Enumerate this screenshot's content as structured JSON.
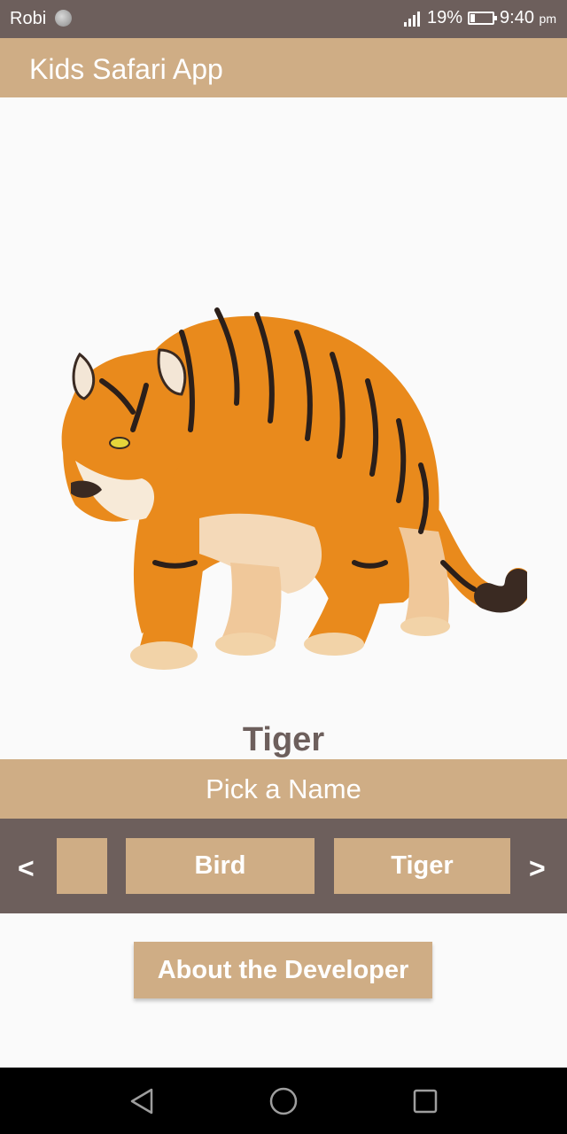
{
  "status": {
    "carrier": "Robi",
    "battery": "19%",
    "time": "9:40",
    "ampm": "pm",
    "battery_level": 0.19
  },
  "app": {
    "title": "Kids Safari App"
  },
  "animal": {
    "name": "Tiger",
    "image_icon": "tiger-illustration"
  },
  "picker": {
    "header": "Pick a Name",
    "prev_label": "<",
    "next_label": ">",
    "options": [
      "",
      "Bird",
      "Tiger"
    ]
  },
  "about": {
    "label": "About the Developer"
  },
  "nav": {
    "icons": [
      "back-triangle-icon",
      "home-circle-icon",
      "recents-square-icon"
    ]
  },
  "colors": {
    "accent": "#cfad85",
    "dark": "#6d5f5c",
    "tiger_orange": "#e98a1c"
  }
}
